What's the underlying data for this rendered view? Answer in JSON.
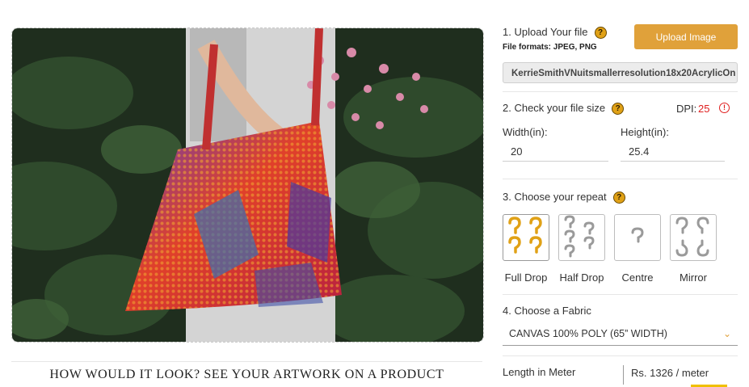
{
  "preview": {
    "caption": "HOW WOULD IT LOOK? SEE YOUR ARTWORK ON A PRODUCT"
  },
  "upload": {
    "step_label": "1. Upload Your file",
    "formats": "File formats: JPEG, PNG",
    "button_label": "Upload Image",
    "filename": "KerrieSmithVNuitsmallerresolution18x20AcrylicOn"
  },
  "file_size": {
    "step_label": "2. Check your file size",
    "dpi_label": "DPI:",
    "dpi_value": "25",
    "width_label": "Width(in):",
    "width_value": "20",
    "height_label": "Height(in):",
    "height_value": "25.4"
  },
  "repeat": {
    "step_label": "3. Choose your repeat",
    "options": [
      {
        "label": "Full Drop",
        "selected": true
      },
      {
        "label": "Half Drop",
        "selected": false
      },
      {
        "label": "Centre",
        "selected": false
      },
      {
        "label": "Mirror",
        "selected": false
      }
    ]
  },
  "fabric": {
    "step_label": "4. Choose a Fabric",
    "selected": "CANVAS 100% POLY (65” WIDTH)"
  },
  "pricing": {
    "length_label": "Length in Meter",
    "price": "Rs. 1326 / meter"
  },
  "colors": {
    "accent": "#e0a13a",
    "warning": "#e02020",
    "help_icon": "#e0a116"
  },
  "icons": [
    "help-icon",
    "warning-icon",
    "chevron-down-icon"
  ]
}
